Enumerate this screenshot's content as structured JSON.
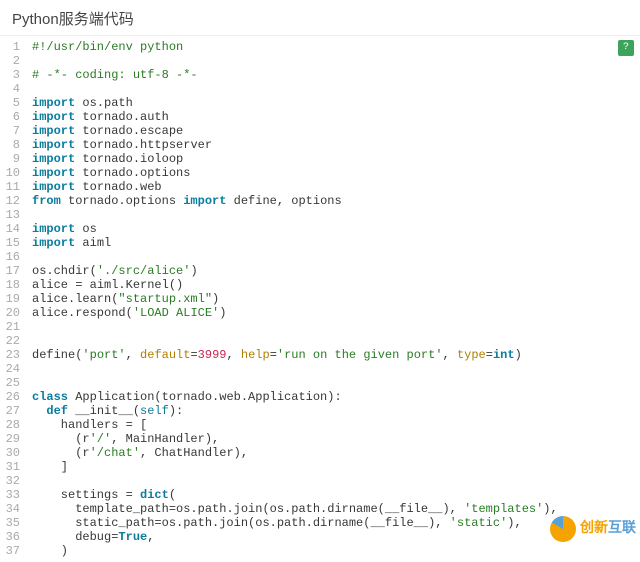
{
  "title": "Python服务端代码",
  "watermark": {
    "text1": "创新",
    "text2": "互联"
  },
  "copy_btn_glyph": "?",
  "code": [
    {
      "n": 1,
      "tokens": [
        [
          "cmt",
          "#!/usr/bin/env python"
        ]
      ]
    },
    {
      "n": 2,
      "tokens": [
        [
          "",
          ""
        ]
      ]
    },
    {
      "n": 3,
      "tokens": [
        [
          "cmt",
          "# -*- coding: utf-8 -*-"
        ]
      ]
    },
    {
      "n": 4,
      "tokens": [
        [
          "",
          ""
        ]
      ]
    },
    {
      "n": 5,
      "tokens": [
        [
          "kw",
          "import"
        ],
        [
          "",
          " os.path"
        ]
      ]
    },
    {
      "n": 6,
      "tokens": [
        [
          "kw",
          "import"
        ],
        [
          "",
          " tornado.auth"
        ]
      ]
    },
    {
      "n": 7,
      "tokens": [
        [
          "kw",
          "import"
        ],
        [
          "",
          " tornado.escape"
        ]
      ]
    },
    {
      "n": 8,
      "tokens": [
        [
          "kw",
          "import"
        ],
        [
          "",
          " tornado.httpserver"
        ]
      ]
    },
    {
      "n": 9,
      "tokens": [
        [
          "kw",
          "import"
        ],
        [
          "",
          " tornado.ioloop"
        ]
      ]
    },
    {
      "n": 10,
      "tokens": [
        [
          "kw",
          "import"
        ],
        [
          "",
          " tornado.options"
        ]
      ]
    },
    {
      "n": 11,
      "tokens": [
        [
          "kw",
          "import"
        ],
        [
          "",
          " tornado.web"
        ]
      ]
    },
    {
      "n": 12,
      "tokens": [
        [
          "kw",
          "from"
        ],
        [
          "",
          " tornado.options "
        ],
        [
          "kw",
          "import"
        ],
        [
          "",
          " define, options"
        ]
      ]
    },
    {
      "n": 13,
      "tokens": [
        [
          "",
          ""
        ]
      ]
    },
    {
      "n": 14,
      "tokens": [
        [
          "kw",
          "import"
        ],
        [
          "",
          " os"
        ]
      ]
    },
    {
      "n": 15,
      "tokens": [
        [
          "kw",
          "import"
        ],
        [
          "",
          " aiml"
        ]
      ]
    },
    {
      "n": 16,
      "tokens": [
        [
          "",
          ""
        ]
      ]
    },
    {
      "n": 17,
      "tokens": [
        [
          "",
          "os.chdir("
        ],
        [
          "str",
          "'./src/alice'"
        ],
        [
          "",
          ")"
        ]
      ]
    },
    {
      "n": 18,
      "tokens": [
        [
          "",
          "alice "
        ],
        [
          "op",
          "="
        ],
        [
          "",
          " aiml.Kernel()"
        ]
      ]
    },
    {
      "n": 19,
      "tokens": [
        [
          "",
          "alice.learn("
        ],
        [
          "str",
          "\"startup.xml\""
        ],
        [
          "",
          ")"
        ]
      ]
    },
    {
      "n": 20,
      "tokens": [
        [
          "",
          "alice.respond("
        ],
        [
          "str",
          "'LOAD ALICE'"
        ],
        [
          "",
          ")"
        ]
      ]
    },
    {
      "n": 21,
      "tokens": [
        [
          "",
          ""
        ]
      ]
    },
    {
      "n": 22,
      "tokens": [
        [
          "",
          ""
        ]
      ]
    },
    {
      "n": 23,
      "tokens": [
        [
          "",
          "define("
        ],
        [
          "str",
          "'port'"
        ],
        [
          "",
          ", "
        ],
        [
          "arg",
          "default"
        ],
        [
          "op",
          "="
        ],
        [
          "num",
          "3999"
        ],
        [
          "",
          ", "
        ],
        [
          "arg",
          "help"
        ],
        [
          "op",
          "="
        ],
        [
          "str",
          "'run on the given port'"
        ],
        [
          "",
          ", "
        ],
        [
          "arg",
          "type"
        ],
        [
          "op",
          "="
        ],
        [
          "builtin",
          "int"
        ],
        [
          "",
          ")"
        ]
      ]
    },
    {
      "n": 24,
      "tokens": [
        [
          "",
          ""
        ]
      ]
    },
    {
      "n": 25,
      "tokens": [
        [
          "",
          ""
        ]
      ]
    },
    {
      "n": 26,
      "tokens": [
        [
          "kw",
          "class"
        ],
        [
          "",
          " Application(tornado.web.Application):"
        ]
      ]
    },
    {
      "n": 27,
      "tokens": [
        [
          "",
          "  "
        ],
        [
          "kw",
          "def"
        ],
        [
          "",
          " __init__("
        ],
        [
          "self",
          "self"
        ],
        [
          "",
          "):"
        ]
      ]
    },
    {
      "n": 28,
      "tokens": [
        [
          "",
          "    handlers "
        ],
        [
          "op",
          "="
        ],
        [
          "",
          " ["
        ]
      ]
    },
    {
      "n": 29,
      "tokens": [
        [
          "",
          "      (r"
        ],
        [
          "str",
          "'/'"
        ],
        [
          "",
          ", MainHandler),"
        ]
      ]
    },
    {
      "n": 30,
      "tokens": [
        [
          "",
          "      (r"
        ],
        [
          "str",
          "'/chat'"
        ],
        [
          "",
          ", ChatHandler),"
        ]
      ]
    },
    {
      "n": 31,
      "tokens": [
        [
          "",
          "    ]"
        ]
      ]
    },
    {
      "n": 32,
      "tokens": [
        [
          "",
          ""
        ]
      ]
    },
    {
      "n": 33,
      "tokens": [
        [
          "",
          "    settings "
        ],
        [
          "op",
          "="
        ],
        [
          "",
          " "
        ],
        [
          "builtin",
          "dict"
        ],
        [
          "",
          "("
        ]
      ]
    },
    {
      "n": 34,
      "tokens": [
        [
          "",
          "      template_path"
        ],
        [
          "op",
          "="
        ],
        [
          "",
          "os.path.join(os.path.dirname(__file__), "
        ],
        [
          "str",
          "'templates'"
        ],
        [
          "",
          "),"
        ]
      ]
    },
    {
      "n": 35,
      "tokens": [
        [
          "",
          "      static_path"
        ],
        [
          "op",
          "="
        ],
        [
          "",
          "os.path.join(os.path.dirname(__file__), "
        ],
        [
          "str",
          "'static'"
        ],
        [
          "",
          "),"
        ]
      ]
    },
    {
      "n": 36,
      "tokens": [
        [
          "",
          "      debug"
        ],
        [
          "op",
          "="
        ],
        [
          "bool",
          "True"
        ],
        [
          "",
          ","
        ]
      ]
    },
    {
      "n": 37,
      "tokens": [
        [
          "",
          "    )"
        ]
      ]
    }
  ]
}
